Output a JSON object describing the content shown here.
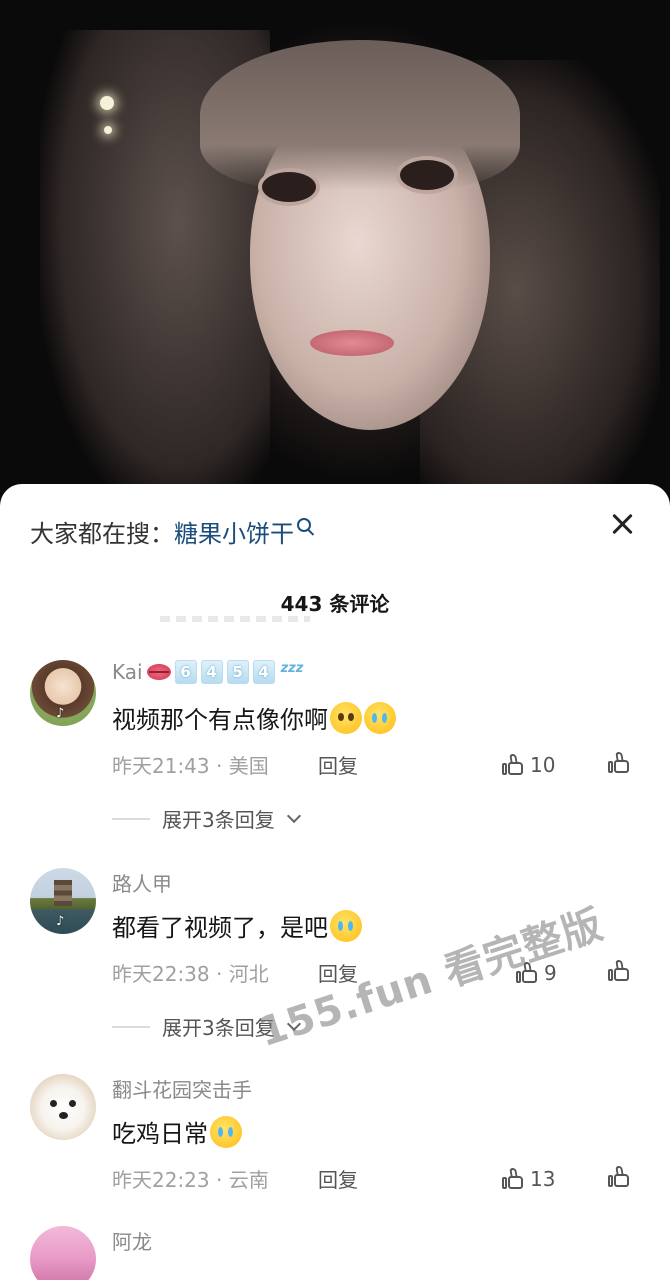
{
  "search": {
    "prefix": "大家都在搜：",
    "term": "糖果小饼干"
  },
  "comments_header": {
    "count_label": "443 条评论"
  },
  "comments": [
    {
      "username": "Kai",
      "level_badges": [
        "6",
        "4",
        "5",
        "4"
      ],
      "text": "视频那个有点像你啊",
      "time_location": "昨天21:43 · 美国",
      "reply_label": "回复",
      "likes": "10",
      "expand_label": "展开3条回复"
    },
    {
      "username": "路人甲",
      "text": "都看了视频了，是吧",
      "time_location": "昨天22:38 · 河北",
      "reply_label": "回复",
      "likes": "9",
      "expand_label": "展开3条回复"
    },
    {
      "username": "翻斗花园突击手",
      "text": "吃鸡日常",
      "time_location": "昨天22:23 · 云南",
      "reply_label": "回复",
      "likes": "13"
    },
    {
      "username": "阿龙"
    }
  ],
  "watermark": "155.fun 看完整版",
  "icons": {
    "search": "search-icon",
    "close": "close-icon",
    "like": "thumbs-up-icon",
    "dislike": "thumbs-down-icon",
    "expand": "chevron-down-icon"
  },
  "colors": {
    "sheet_bg": "#ffffff",
    "search_term": "#1c4d7a",
    "secondary_text": "#8a8a8a"
  }
}
